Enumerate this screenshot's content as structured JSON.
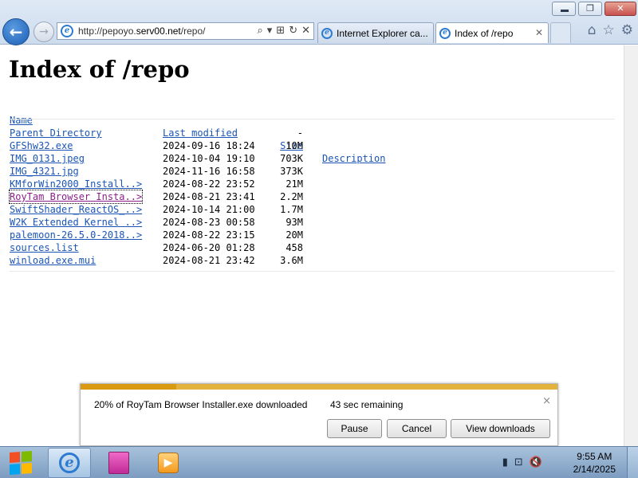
{
  "window": {
    "minimize_label": "",
    "restore_label": "❐",
    "close_label": "✕"
  },
  "toolbar": {
    "back_label": "←",
    "forward_label": "→",
    "address_url_prefix": "http://pepoyo.",
    "address_url_domain": "serv00.net",
    "address_url_suffix": "/repo/",
    "address_icons": [
      "⌕",
      "▾",
      "⊞",
      "↻",
      "✕"
    ],
    "right_icons": [
      "⌂",
      "☆",
      "⚙"
    ]
  },
  "tabs": [
    {
      "label": "Internet Explorer ca...",
      "active": false
    },
    {
      "label": "Index of /repo",
      "active": true,
      "close": "✕"
    }
  ],
  "page": {
    "title": "Index of /repo",
    "headers": {
      "name": "Name",
      "modified": "Last modified",
      "size": "Size",
      "description": "Description"
    },
    "rows": [
      {
        "name": "Parent Directory",
        "modified": "",
        "size": "-",
        "visited": false
      },
      {
        "name": "GFShw32.exe",
        "modified": "2024-09-16 18:24",
        "size": "10M",
        "visited": false
      },
      {
        "name": "IMG_0131.jpeg",
        "modified": "2024-10-04 19:10",
        "size": "703K",
        "visited": false
      },
      {
        "name": "IMG_4321.jpg",
        "modified": "2024-11-16 16:58",
        "size": "373K",
        "visited": false
      },
      {
        "name": "KMforWin2000_Install..>",
        "modified": "2024-08-22 23:52",
        "size": "21M",
        "visited": false
      },
      {
        "name": "RoyTam Browser Insta..>",
        "modified": "2024-08-21 23:41",
        "size": "2.2M",
        "visited": true
      },
      {
        "name": "SwiftShader_ReactOS_..>",
        "modified": "2024-10-14 21:00",
        "size": "1.7M",
        "visited": false
      },
      {
        "name": "W2K Extended Kernel ..>",
        "modified": "2024-08-23 00:58",
        "size": "93M",
        "visited": false
      },
      {
        "name": "palemoon-26.5.0-2018..>",
        "modified": "2024-08-22 23:15",
        "size": "20M",
        "visited": false
      },
      {
        "name": "sources.list",
        "modified": "2024-06-20 01:28",
        "size": "458",
        "visited": false
      },
      {
        "name": "winload.exe.mui",
        "modified": "2024-08-21 23:42",
        "size": "3.6M",
        "visited": false
      }
    ]
  },
  "download": {
    "progress_percent": 20,
    "status_text": "20% of RoyTam Browser Installer.exe downloaded",
    "remaining_text": "43 sec remaining",
    "close_label": "×",
    "pause_label": "Pause",
    "cancel_label": "Cancel",
    "view_label": "View downloads",
    "progress_color": "#e3b23c"
  },
  "taskbar": {
    "start_colors": [
      "#f25022",
      "#7fba00",
      "#00a4ef",
      "#ffb900"
    ],
    "tray_icons": [
      "▮",
      "⊡",
      "🔇"
    ],
    "time": "9:55 AM",
    "date": "2/14/2025"
  }
}
